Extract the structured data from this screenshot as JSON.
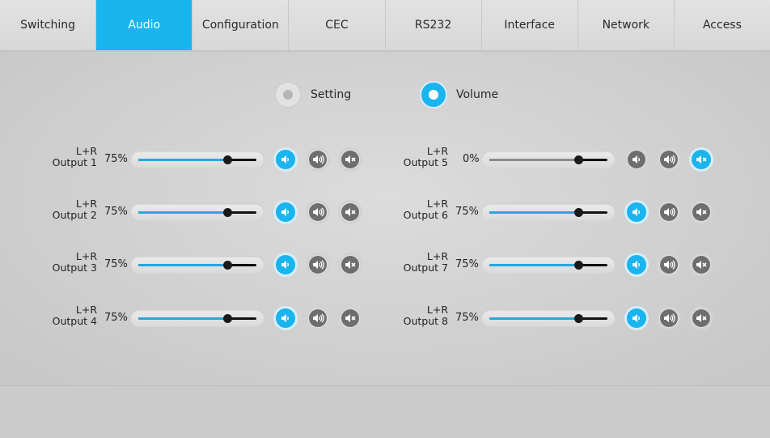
{
  "tabs": [
    {
      "label": "Switching"
    },
    {
      "label": "Audio",
      "active": true
    },
    {
      "label": "Configuration"
    },
    {
      "label": "CEC"
    },
    {
      "label": "RS232"
    },
    {
      "label": "Interface"
    },
    {
      "label": "Network"
    },
    {
      "label": "Access"
    }
  ],
  "mode": {
    "setting_label": "Setting",
    "volume_label": "Volume",
    "selected": "Volume"
  },
  "outputs": [
    {
      "line1": "L+R",
      "line2": "Output 1",
      "volume_text": "75%",
      "level": 0.75,
      "slider_fill": "blue",
      "button_active": "volume-low-icon"
    },
    {
      "line1": "L+R",
      "line2": "Output 2",
      "volume_text": "75%",
      "level": 0.75,
      "slider_fill": "blue",
      "button_active": "volume-low-icon"
    },
    {
      "line1": "L+R",
      "line2": "Output 3",
      "volume_text": "75%",
      "level": 0.75,
      "slider_fill": "blue",
      "button_active": "volume-low-icon"
    },
    {
      "line1": "L+R",
      "line2": "Output 4",
      "volume_text": "75%",
      "level": 0.75,
      "slider_fill": "blue",
      "button_active": "volume-low-icon"
    },
    {
      "line1": "L+R",
      "line2": "Output 5",
      "volume_text": "0%",
      "level": 0.75,
      "slider_fill": "grey",
      "button_active": "mute-icon"
    },
    {
      "line1": "L+R",
      "line2": "Output 6",
      "volume_text": "75%",
      "level": 0.75,
      "slider_fill": "blue",
      "button_active": "volume-low-icon"
    },
    {
      "line1": "L+R",
      "line2": "Output 7",
      "volume_text": "75%",
      "level": 0.75,
      "slider_fill": "blue",
      "button_active": "volume-low-icon"
    },
    {
      "line1": "L+R",
      "line2": "Output 8",
      "volume_text": "75%",
      "level": 0.75,
      "slider_fill": "blue",
      "button_active": "volume-low-icon"
    }
  ],
  "buttons": [
    "volume-low-icon",
    "volume-high-icon",
    "mute-icon"
  ],
  "colors": {
    "accent": "#1ab4ef",
    "slider_fill": "#2aa6dc",
    "button_off": "#6e6e6e"
  }
}
